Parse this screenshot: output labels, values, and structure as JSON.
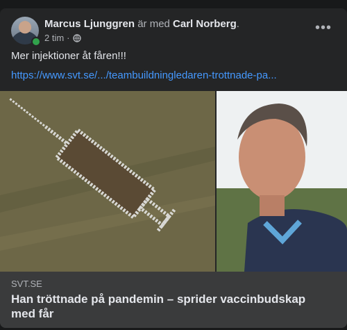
{
  "post": {
    "author": "Marcus Ljunggren",
    "with_text": "är med",
    "tagged": "Carl Norberg",
    "tag_suffix": ".",
    "time": "2 tim",
    "separator": "·",
    "privacy_icon": "globe-icon",
    "more_label": "•••",
    "text": "Mer injektioner åt fåren!!!",
    "link": "https://www.svt.se/.../teambuildningledaren-trottnade-pa..."
  },
  "link_card": {
    "domain": "SVT.SE",
    "headline": "Han tröttnade på pandemin – sprider vaccinbudskap med får"
  },
  "colors": {
    "background": "#18191a",
    "card": "#242526",
    "link": "#4599ff",
    "online": "#31a24c"
  }
}
